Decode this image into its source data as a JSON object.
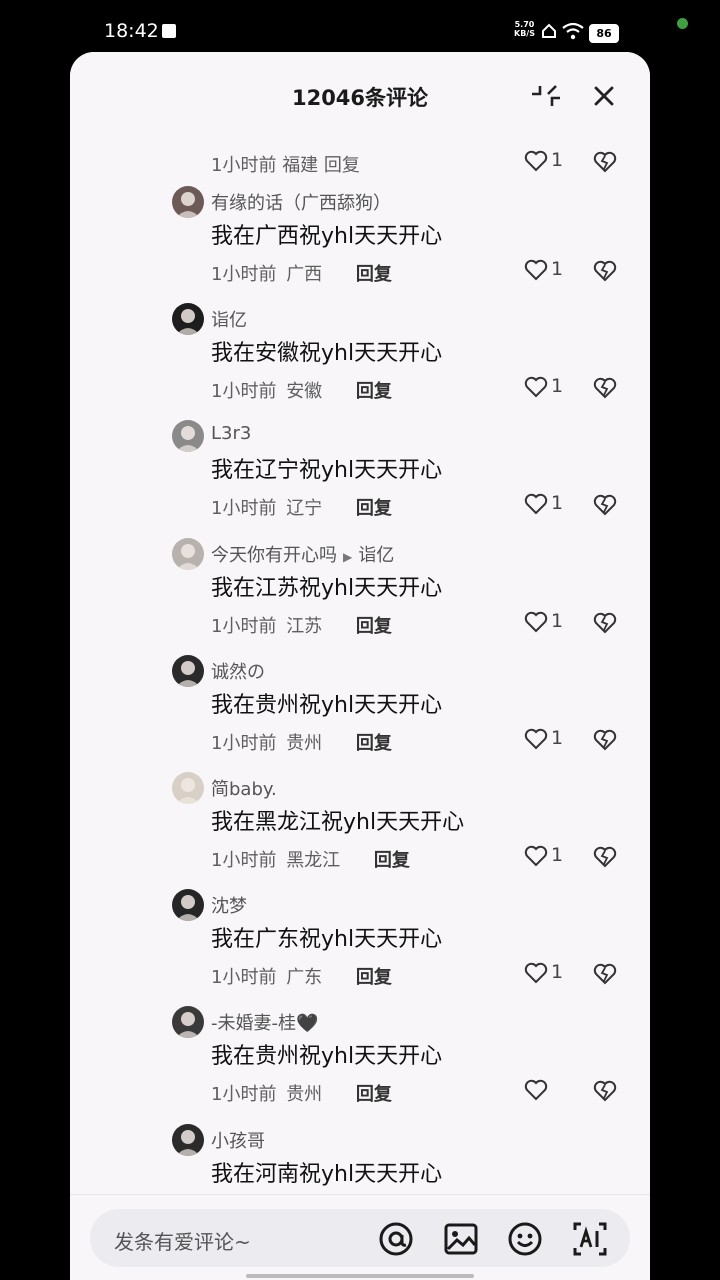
{
  "status_bar": {
    "time": "18:42",
    "net_speed_value": "5.70",
    "net_speed_unit": "KB/S",
    "battery": "86"
  },
  "header": {
    "title": "12046条评论",
    "collapse_icon": "collapse-icon",
    "close_icon": "close-icon"
  },
  "partial_comment": {
    "time": "1小时前",
    "location": "福建",
    "reply_label": "回复",
    "likes": "1"
  },
  "comments": [
    {
      "username": "有缘的话（广西舔狗）",
      "text": "我在广西祝yhl天天开心",
      "time": "1小时前",
      "location": "广西",
      "reply_label": "回复",
      "likes": "1"
    },
    {
      "username": "诣亿",
      "text": "我在安徽祝yhl天天开心",
      "time": "1小时前",
      "location": "安徽",
      "reply_label": "回复",
      "likes": "1"
    },
    {
      "username": "L3r3",
      "text": "我在辽宁祝yhl天天开心",
      "time": "1小时前",
      "location": "辽宁",
      "reply_label": "回复",
      "likes": "1"
    },
    {
      "username": "今天你有开心吗",
      "reply_to": "诣亿",
      "text": "我在江苏祝yhl天天开心",
      "time": "1小时前",
      "location": "江苏",
      "reply_label": "回复",
      "likes": "1"
    },
    {
      "username": "诚然の",
      "text": "我在贵州祝yhl天天开心",
      "time": "1小时前",
      "location": "贵州",
      "reply_label": "回复",
      "likes": "1"
    },
    {
      "username": "简baby.",
      "text": "我在黑龙江祝yhl天天开心",
      "time": "1小时前",
      "location": "黑龙江",
      "reply_label": "回复",
      "likes": "1"
    },
    {
      "username": "沈梦",
      "text": "我在广东祝yhl天天开心",
      "time": "1小时前",
      "location": "广东",
      "reply_label": "回复",
      "likes": "1"
    },
    {
      "username": "-未婚妻-桂🖤",
      "text": "我在贵州祝yhl天天开心",
      "time": "1小时前",
      "location": "贵州",
      "reply_label": "回复",
      "likes": ""
    },
    {
      "username": "小孩哥",
      "text": "我在河南祝yhl天天开心",
      "time": "",
      "location": "",
      "reply_label": "",
      "likes": ""
    }
  ],
  "input_bar": {
    "placeholder": "发条有爱评论~",
    "icons": [
      "at-icon",
      "image-icon",
      "emoji-icon",
      "ai-icon"
    ]
  }
}
